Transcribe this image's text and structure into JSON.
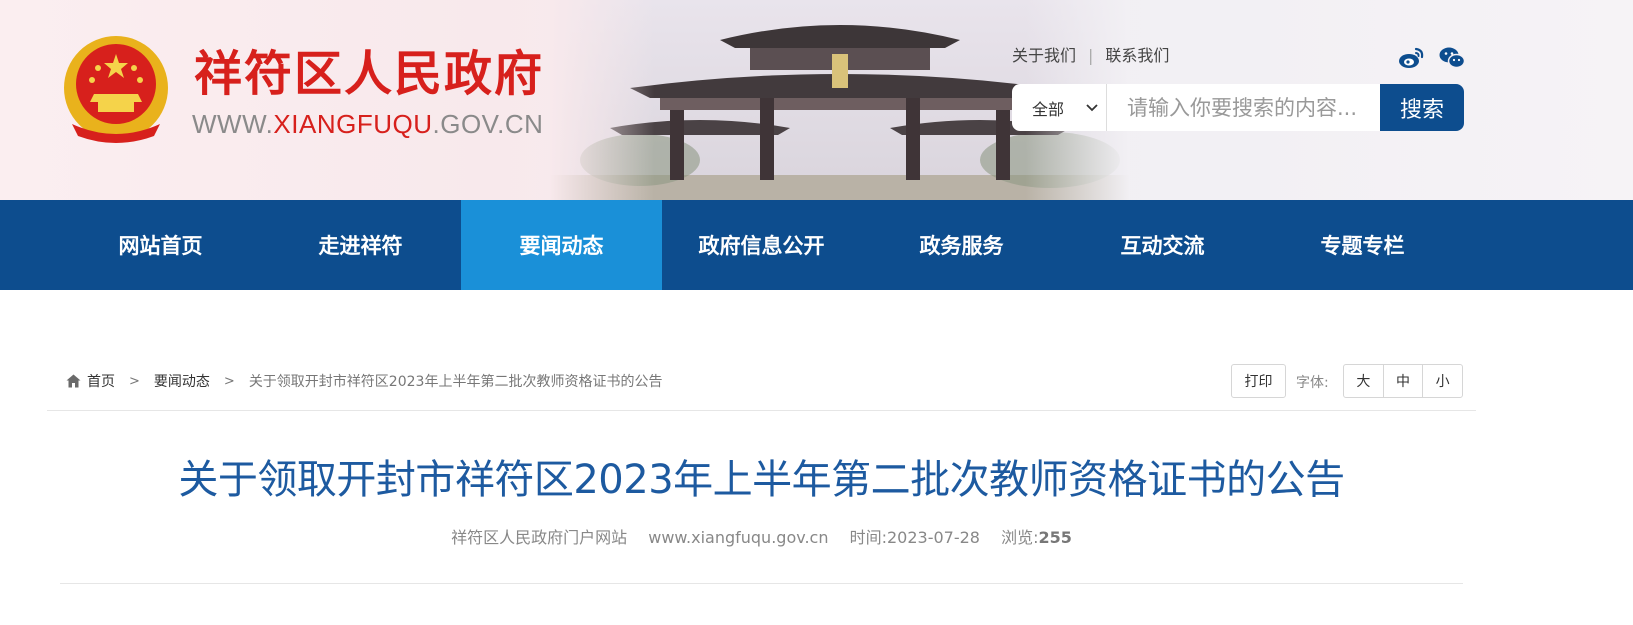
{
  "header": {
    "site_name": "祥符区人民政府",
    "url_prefix": "WWW.",
    "url_highlight": "XIANGFUQU",
    "url_suffix": ".GOV.CN",
    "links": [
      "关于我们",
      "联系我们"
    ],
    "separator": "|",
    "social_icons": [
      "weibo-icon",
      "wechat-icon"
    ],
    "search": {
      "scope_selected": "全部",
      "placeholder": "请输入你要搜索的内容...",
      "button_label": "搜索"
    }
  },
  "nav": {
    "items": [
      {
        "label": "网站首页"
      },
      {
        "label": "走进祥符"
      },
      {
        "label": "要闻动态"
      },
      {
        "label": "政府信息公开"
      },
      {
        "label": "政务服务"
      },
      {
        "label": "互动交流"
      },
      {
        "label": "专题专栏"
      }
    ],
    "active_index": 2
  },
  "breadcrumb": {
    "home": "首页",
    "section": "要闻动态",
    "current": "关于领取开封市祥符区2023年上半年第二批次教师资格证书的公告",
    "arrow": ">"
  },
  "tools": {
    "print_label": "打印",
    "font_label": "字体:",
    "font_sizes": [
      "大",
      "中",
      "小"
    ]
  },
  "article": {
    "title": "关于领取开封市祥符区2023年上半年第二批次教师资格证书的公告",
    "source": "祥符区人民政府门户网站",
    "site": "www.xiangfuqu.gov.cn",
    "time_label": "时间:",
    "date": "2023-07-28",
    "views_label": "浏览:",
    "views": "255"
  },
  "colors": {
    "brand_red": "#d7201c",
    "nav_blue": "#0d4d8e",
    "nav_active": "#1a90d8",
    "title_blue": "#1d5aa0"
  }
}
